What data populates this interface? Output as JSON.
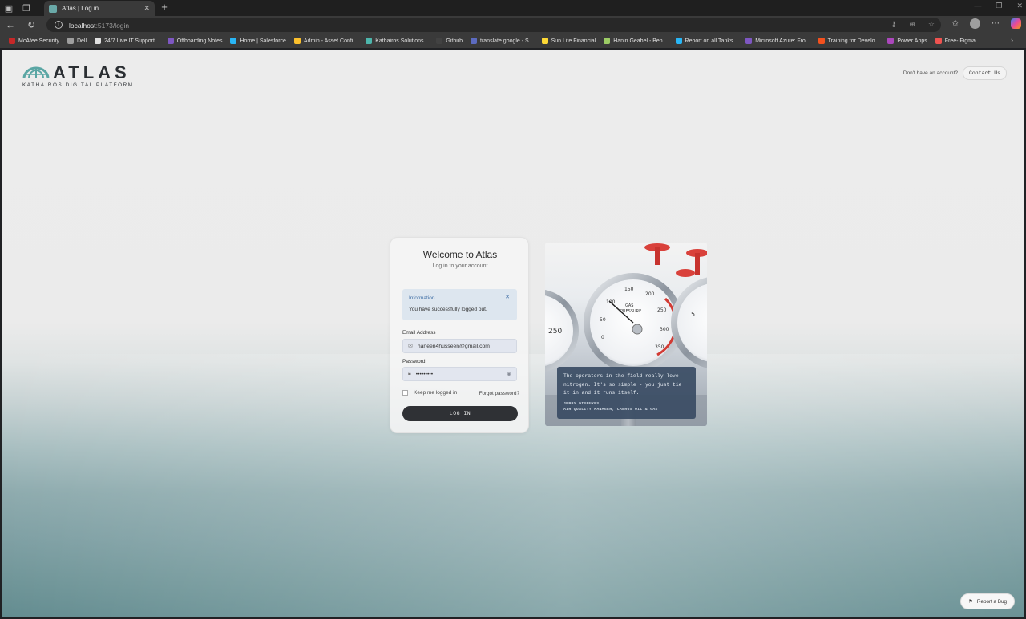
{
  "browser": {
    "tab_title": "Atlas | Log in",
    "url_host": "localhost",
    "url_path": ":5173/login",
    "bookmarks": [
      {
        "label": "McAfee Security",
        "color": "#c62828"
      },
      {
        "label": "Dell",
        "color": "#9e9e9e"
      },
      {
        "label": "24/7 Live IT Support...",
        "color": "#e0e0e0"
      },
      {
        "label": "Offboarding Notes",
        "color": "#7e57c2"
      },
      {
        "label": "Home | Salesforce",
        "color": "#29b6f6"
      },
      {
        "label": "Admin - Asset Confi...",
        "color": "#fbc02d"
      },
      {
        "label": "Kathairos Solutions...",
        "color": "#4db6ac"
      },
      {
        "label": "Github",
        "color": "#424242"
      },
      {
        "label": "translate google - S...",
        "color": "#5c6bc0"
      },
      {
        "label": "Sun Life Financial",
        "color": "#fdd835"
      },
      {
        "label": "Hanin Geabel - Ben...",
        "color": "#9ccc65"
      },
      {
        "label": "Report on all Tanks...",
        "color": "#29b6f6"
      },
      {
        "label": "Microsoft Azure: Fro...",
        "color": "#7e57c2"
      },
      {
        "label": "Training for Develo...",
        "color": "#f4511e"
      },
      {
        "label": "Power Apps",
        "color": "#ab47bc"
      },
      {
        "label": "Free- Figma",
        "color": "#ef5350"
      }
    ]
  },
  "header": {
    "logo_word": "ATLAS",
    "logo_sub": "KATHAIROS DIGITAL PLATFORM",
    "no_account": "Don't have an account?",
    "contact_label": "Contact Us"
  },
  "login": {
    "title": "Welcome to Atlas",
    "subtitle": "Log in to your account",
    "alert_title": "Information",
    "alert_message": "You have successfully logged out.",
    "email_label": "Email Address",
    "email_value": "haneen4husseen@gmail.com",
    "password_label": "Password",
    "password_value": "•••••••••",
    "remember_label": "Keep me logged in",
    "forgot_label": "Forgot password?",
    "login_button": "LOG IN"
  },
  "testimonial": {
    "quote": "The operators in the field really love nitrogen. It's so simple - you just tie it in and it runs itself.",
    "author_name": "JERRY DISMUKES",
    "author_title": "AIR QUALITY MANAGER, CAERUS OIL & GAS"
  },
  "report_bug": "Report a Bug",
  "colors": {
    "accent_teal": "#5aa6a4",
    "button_dark": "#2f3135",
    "alert_bg": "#dde6ef",
    "alert_text": "#3f6ea5"
  }
}
